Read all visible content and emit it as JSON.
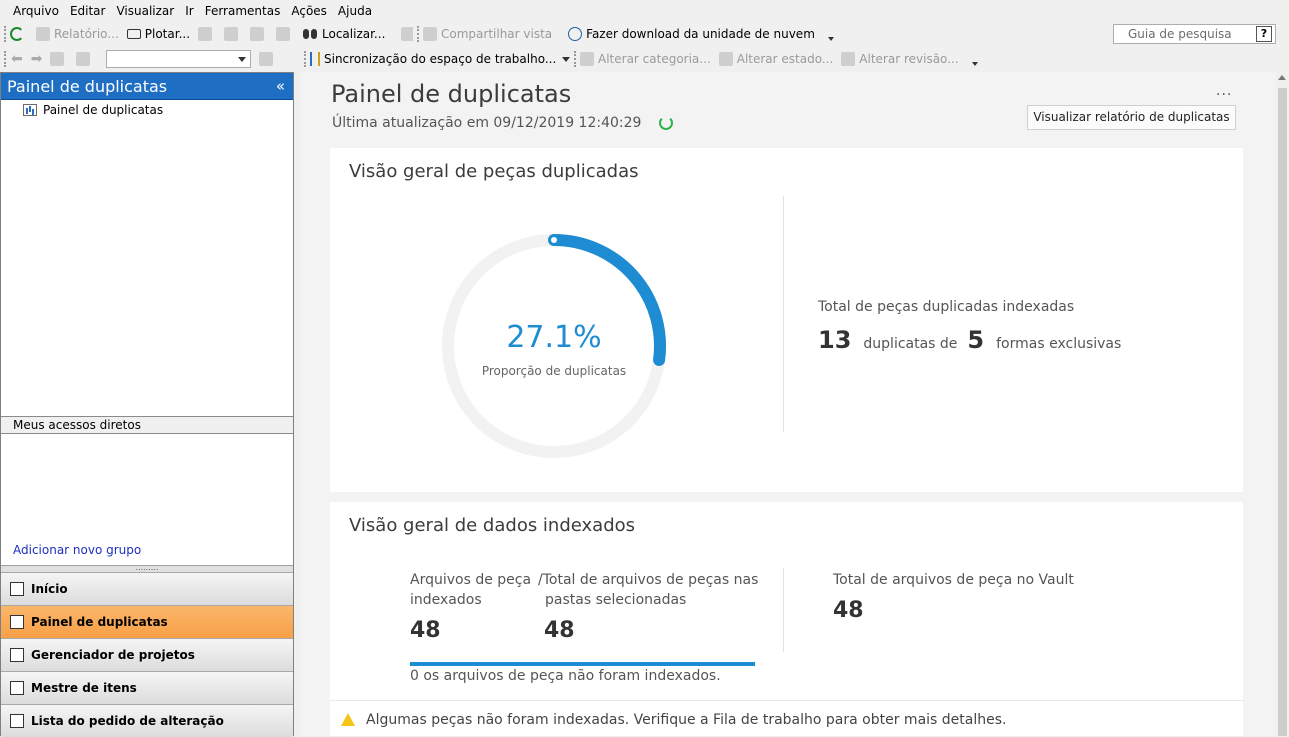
{
  "menu": [
    "Arquivo",
    "Editar",
    "Visualizar",
    "Ir",
    "Ferramentas",
    "Ações",
    "Ajuda"
  ],
  "toolbar1": {
    "report": "Relatório...",
    "plot": "Plotar...",
    "find": "Localizar...",
    "share_view": "Compartilhar vista",
    "cloud_download": "Fazer download da unidade de nuvem"
  },
  "toolbar2": {
    "workspace_sync": "Sincronização do espaço de trabalho...",
    "change_category": "Alterar categoria...",
    "change_state": "Alterar estado...",
    "change_revision": "Alterar revisão..."
  },
  "search": {
    "placeholder": "Guia de pesquisa",
    "help": "?"
  },
  "left_pane": {
    "title": "Painel de duplicatas",
    "collapse": "«",
    "tree_item": "Painel de duplicatas",
    "shortcuts_header": "Meus acessos diretos",
    "add_group": "Adicionar novo grupo",
    "nav": [
      "Início",
      "Painel de duplicatas",
      "Gerenciador de projetos",
      "Mestre de itens",
      "Lista do pedido de alteração"
    ]
  },
  "main": {
    "title": "Painel de duplicatas",
    "last_update": "Última atualização em 09/12/2019 12:40:29",
    "more": "···",
    "report_button": "Visualizar relatório de duplicatas",
    "overview": {
      "title": "Visão geral de peças duplicadas",
      "ratio_value": 0.271,
      "ratio_text": "27.1%",
      "ratio_label": "Proporção de duplicatas",
      "total_label": "Total de peças duplicadas indexadas",
      "duplicates_count": "13",
      "duplicates_of": "duplicatas de",
      "unique_count": "5",
      "unique_label": "formas exclusivas"
    },
    "indexed": {
      "title": "Visão geral de dados indexados",
      "indexed_label_1": "Arquivos de peça",
      "indexed_label_2": "indexados",
      "indexed_value": "48",
      "total_sel_label_1": "/Total de arquivos de peças nas",
      "total_sel_label_2": "pastas selecionadas",
      "total_sel_value": "48",
      "vault_label": "Total de arquivos de peça no Vault",
      "vault_value": "48",
      "not_indexed": "0  os arquivos de peça não foram indexados."
    },
    "notice": "Algumas peças não foram indexadas. Verifique a Fila de trabalho para obter mais detalhes."
  },
  "colors": {
    "accent": "#1e8cd2",
    "nav_active": "#f7a048",
    "header_blue": "#1e6fc4",
    "track": "#f2f2f2"
  }
}
